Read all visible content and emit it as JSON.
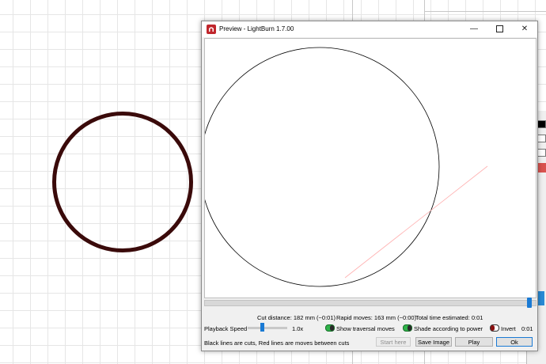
{
  "window": {
    "title": "Preview - LightBurn 1.7.00",
    "min_glyph": "—",
    "close_glyph": "✕"
  },
  "stats": {
    "cut_distance": "Cut distance: 182 mm (~0:01)",
    "rapid_moves": "Rapid moves: 163 mm (~0:00)",
    "total_time": "Total time estimated: 0:01"
  },
  "controls": {
    "playback_speed_label": "Playback Speed",
    "playback_speed_value": "1.0x",
    "show_traversal_label": "Show traversal moves",
    "shade_label": "Shade according to power",
    "invert_label": "Invert",
    "invert_time": "0:01"
  },
  "footer": {
    "legend": "Black lines are cuts, Red lines are moves between cuts",
    "start_here": "Start here",
    "save_image": "Save Image",
    "play": "Play",
    "ok": "Ok"
  },
  "colors": {
    "cut_line": "#000000",
    "traversal_line": "#ffb0b0",
    "accent": "#1a7ad4",
    "design_circle": "#3a0a0a"
  }
}
